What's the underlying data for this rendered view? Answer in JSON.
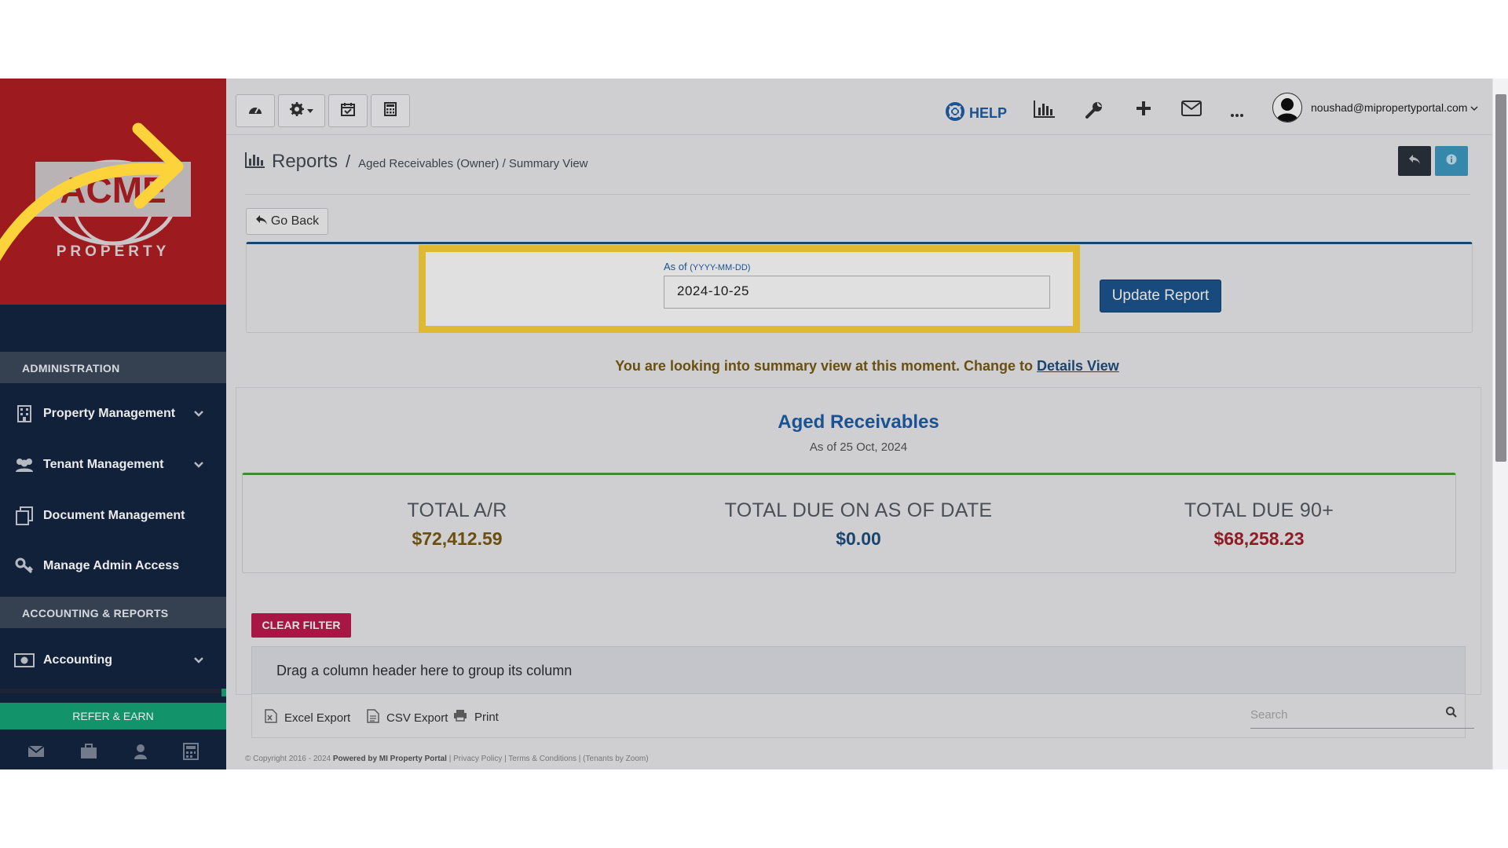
{
  "logo": {
    "text": "ACME",
    "subtext": "PROPERTY"
  },
  "sidebar": {
    "section_admin": "ADMINISTRATION",
    "section_accounting": "ACCOUNTING & REPORTS",
    "items": [
      {
        "label": "Property Management",
        "icon": "building-icon",
        "has_chevron": true
      },
      {
        "label": "Tenant Management",
        "icon": "users-icon",
        "has_chevron": true
      },
      {
        "label": "Document Management",
        "icon": "documents-icon",
        "has_chevron": false
      },
      {
        "label": "Manage Admin Access",
        "icon": "key-icon",
        "has_chevron": false
      }
    ],
    "accounting_item": {
      "label": "Accounting",
      "icon": "money-icon"
    },
    "refer_label": "REFER & EARN",
    "bottom_icons": [
      "mail-icon",
      "briefcase-icon",
      "user-icon",
      "calculator-icon"
    ]
  },
  "topbar": {
    "help_label": "HELP",
    "user_email": "noushad@mipropertyportal.com"
  },
  "breadcrumb": {
    "title": "Reports",
    "separator": "/",
    "path": "Aged Receivables (Owner) / Summary View"
  },
  "go_back_label": "Go Back",
  "filter": {
    "label": "As of",
    "label_hint": "(YYYY-MM-DD)",
    "date_value": "2024-10-25",
    "update_label": "Update Report"
  },
  "notice": {
    "text": "You are looking into summary view at this moment. Change to",
    "link": "Details View"
  },
  "report": {
    "title": "Aged Receivables",
    "subtitle": "As of 25 Oct, 2024",
    "totals": [
      {
        "label": "TOTAL A/R",
        "value": "$72,412.59",
        "color": "#7a5a10"
      },
      {
        "label": "TOTAL DUE ON AS OF DATE",
        "value": "$0.00",
        "color": "#1e4f80"
      },
      {
        "label": "TOTAL DUE 90+",
        "value": "$68,258.23",
        "color": "#a3202a"
      }
    ]
  },
  "grid": {
    "clear_filter_label": "CLEAR FILTER",
    "group_hint": "Drag a column header here to group its column",
    "excel_label": "Excel Export",
    "csv_label": "CSV Export",
    "print_label": "Print",
    "search_placeholder": "Search"
  },
  "footer": {
    "copyright": "© Copyright 2016 - 2024",
    "powered": "Powered by MI Property Portal",
    "links": "| Privacy Policy | Terms & Conditions |",
    "tenants": "(Tenants by Zoom)"
  },
  "colors": {
    "brand_red": "#9d1a1e",
    "sidebar_navy": "#14243f",
    "highlight_yellow": "#fdd33c",
    "primary_blue": "#1c5590",
    "clear_filter": "#c01a4f",
    "refer_green": "#15a074"
  }
}
